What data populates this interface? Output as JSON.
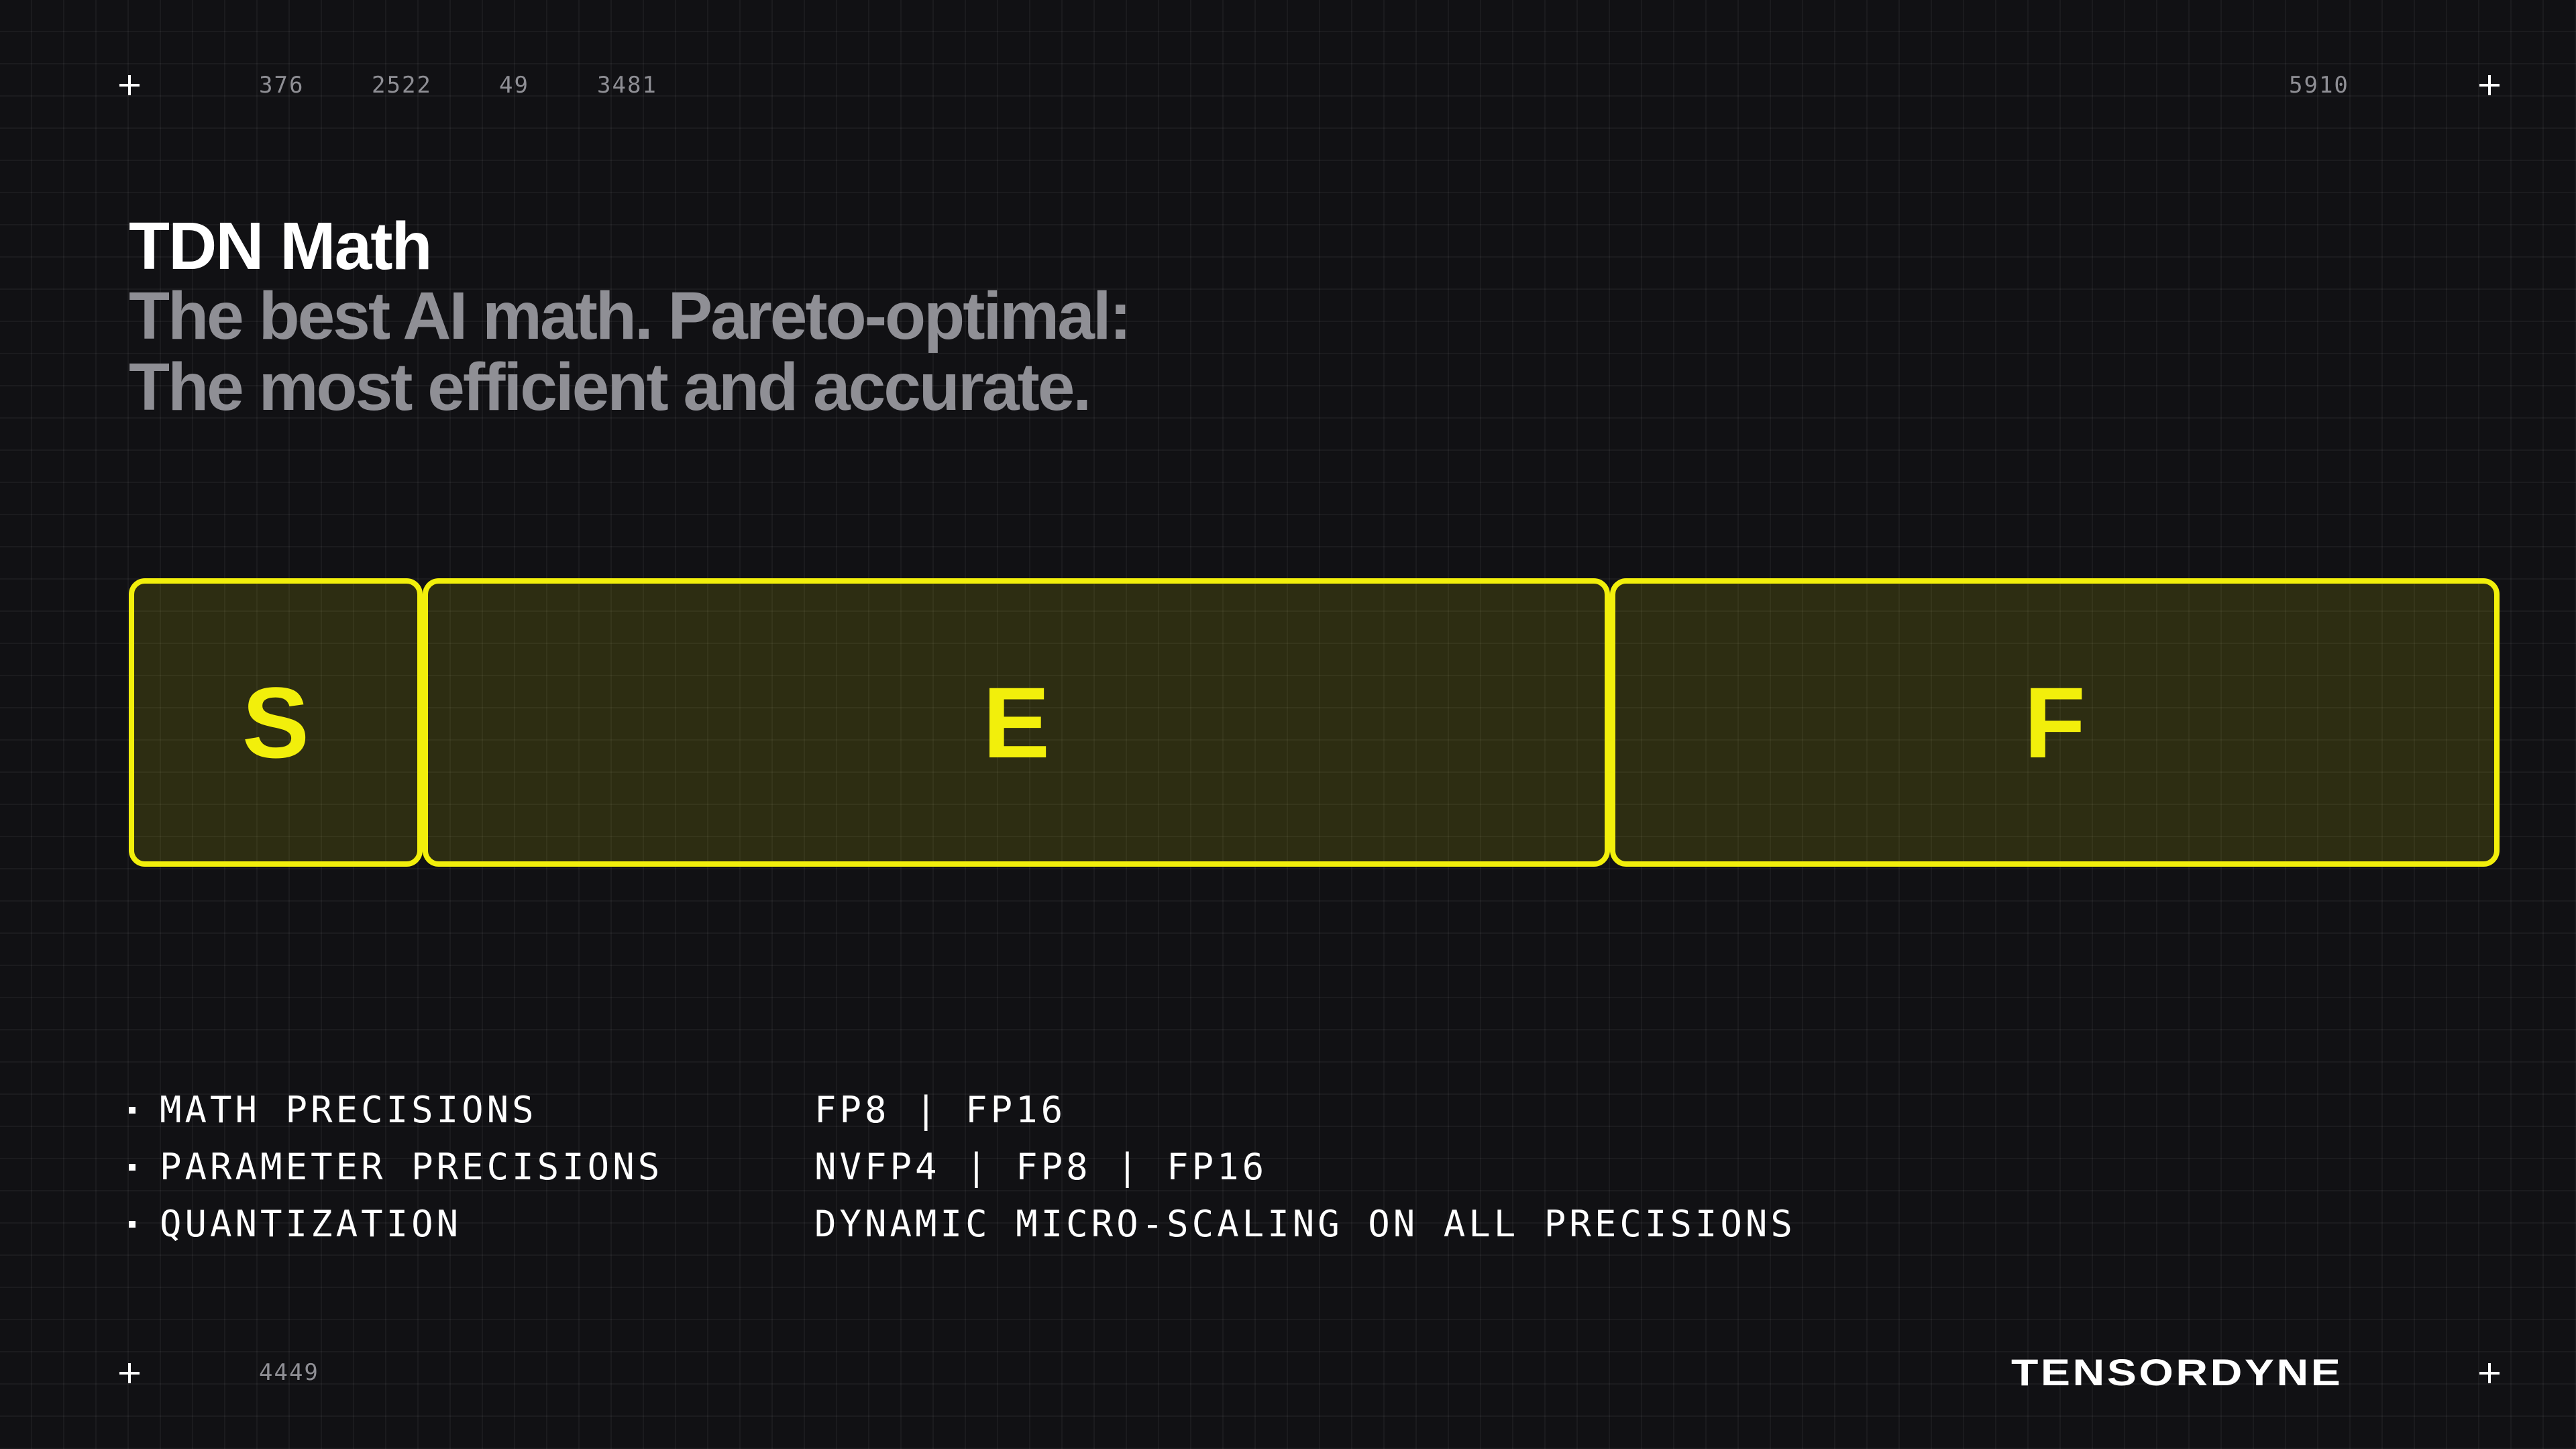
{
  "corner_numbers": {
    "top": [
      "376",
      "2522",
      "49",
      "3481"
    ],
    "top_right": "5910",
    "bottom_left": "4449"
  },
  "header": {
    "title": "TDN Math",
    "subtitle_line1": "The best AI math. Pareto-optimal:",
    "subtitle_line2": "The most efficient and accurate."
  },
  "format_fields": {
    "sign": "S",
    "exponent": "E",
    "fraction": "F",
    "accent_color": "#f2ef0b"
  },
  "specs": [
    {
      "label": "MATH PRECISIONS",
      "value": "FP8 | FP16"
    },
    {
      "label": "PARAMETER PRECISIONS",
      "value": "NVFP4 | FP8 | FP16"
    },
    {
      "label": "QUANTIZATION",
      "value": "DYNAMIC MICRO-SCALING ON ALL PRECISIONS"
    }
  ],
  "logo": {
    "text": "TENSORDYNE"
  },
  "colors": {
    "background": "#111114",
    "muted_text": "#8f8f95",
    "primary_text": "#ffffff"
  },
  "icons": [
    "plus-icon"
  ]
}
